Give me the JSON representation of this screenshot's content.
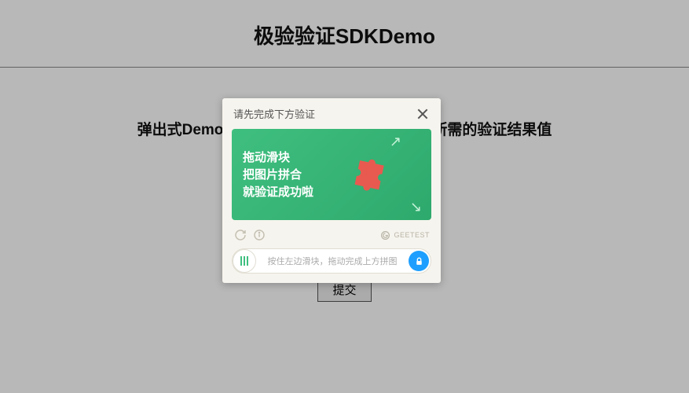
{
  "page": {
    "title": "极验验证SDKDemo",
    "subtitle": "弹出式Demo，点击提交进行验证并获取表单所需的验证结果值",
    "submit_label": "提交"
  },
  "modal": {
    "header_title": "请先完成下方验证",
    "puzzle_line1": "拖动滑块",
    "puzzle_line2": "把图片拼合",
    "puzzle_line3": "就验证成功啦",
    "brand_label": "GEETEST",
    "slider_hint": "按住左边滑块，拖动完成上方拼图"
  }
}
